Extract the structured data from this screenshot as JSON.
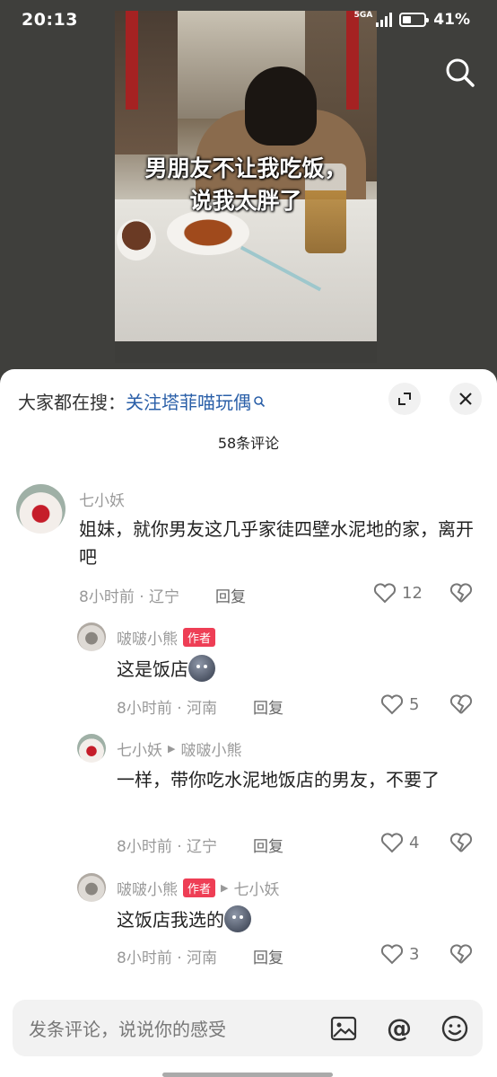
{
  "status_bar": {
    "time": "20:13",
    "network": "5GA",
    "battery_percent": "41%",
    "battery_level": 0.41
  },
  "video": {
    "caption_line1": "男朋友不让我吃饭，",
    "caption_line2": "说我太胖了"
  },
  "sheet": {
    "search_prefix": "大家都在搜：",
    "search_term": "关注塔菲喵玩偶",
    "comment_count": "58条评论"
  },
  "comments": [
    {
      "name": "七小妖",
      "text": "姐妹，就你男友这几乎家徒四壁水泥地的家，离开吧",
      "time_location": "8小时前 · 辽宁",
      "reply_label": "回复",
      "likes": "12"
    },
    {
      "name": "啵啵小熊",
      "badge": "作者",
      "text": "这是饭店",
      "time_location": "8小时前 · 河南",
      "reply_label": "回复",
      "likes": "5"
    },
    {
      "name": "七小妖",
      "reply_to": "啵啵小熊",
      "text": "一样，带你吃水泥地饭店的男友，不要了",
      "time_location": "8小时前 · 辽宁",
      "reply_label": "回复",
      "likes": "4"
    },
    {
      "name": "啵啵小熊",
      "badge": "作者",
      "reply_to": "七小妖",
      "text": "这饭店我选的",
      "time_location": "8小时前 · 河南",
      "reply_label": "回复",
      "likes": "3"
    }
  ],
  "input": {
    "placeholder": "发条评论，说说你的感受"
  },
  "icons": {
    "search": "search-icon",
    "expand": "expand-icon",
    "close": "close-icon",
    "like": "heart-icon",
    "dislike": "broken-heart-icon",
    "image": "image-icon",
    "mention": "at-icon",
    "emoji": "emoji-icon"
  },
  "colors": {
    "accent_blue": "#2a5fa8",
    "author_badge": "#ee3e55",
    "background_dark": "#3f3f3c"
  }
}
